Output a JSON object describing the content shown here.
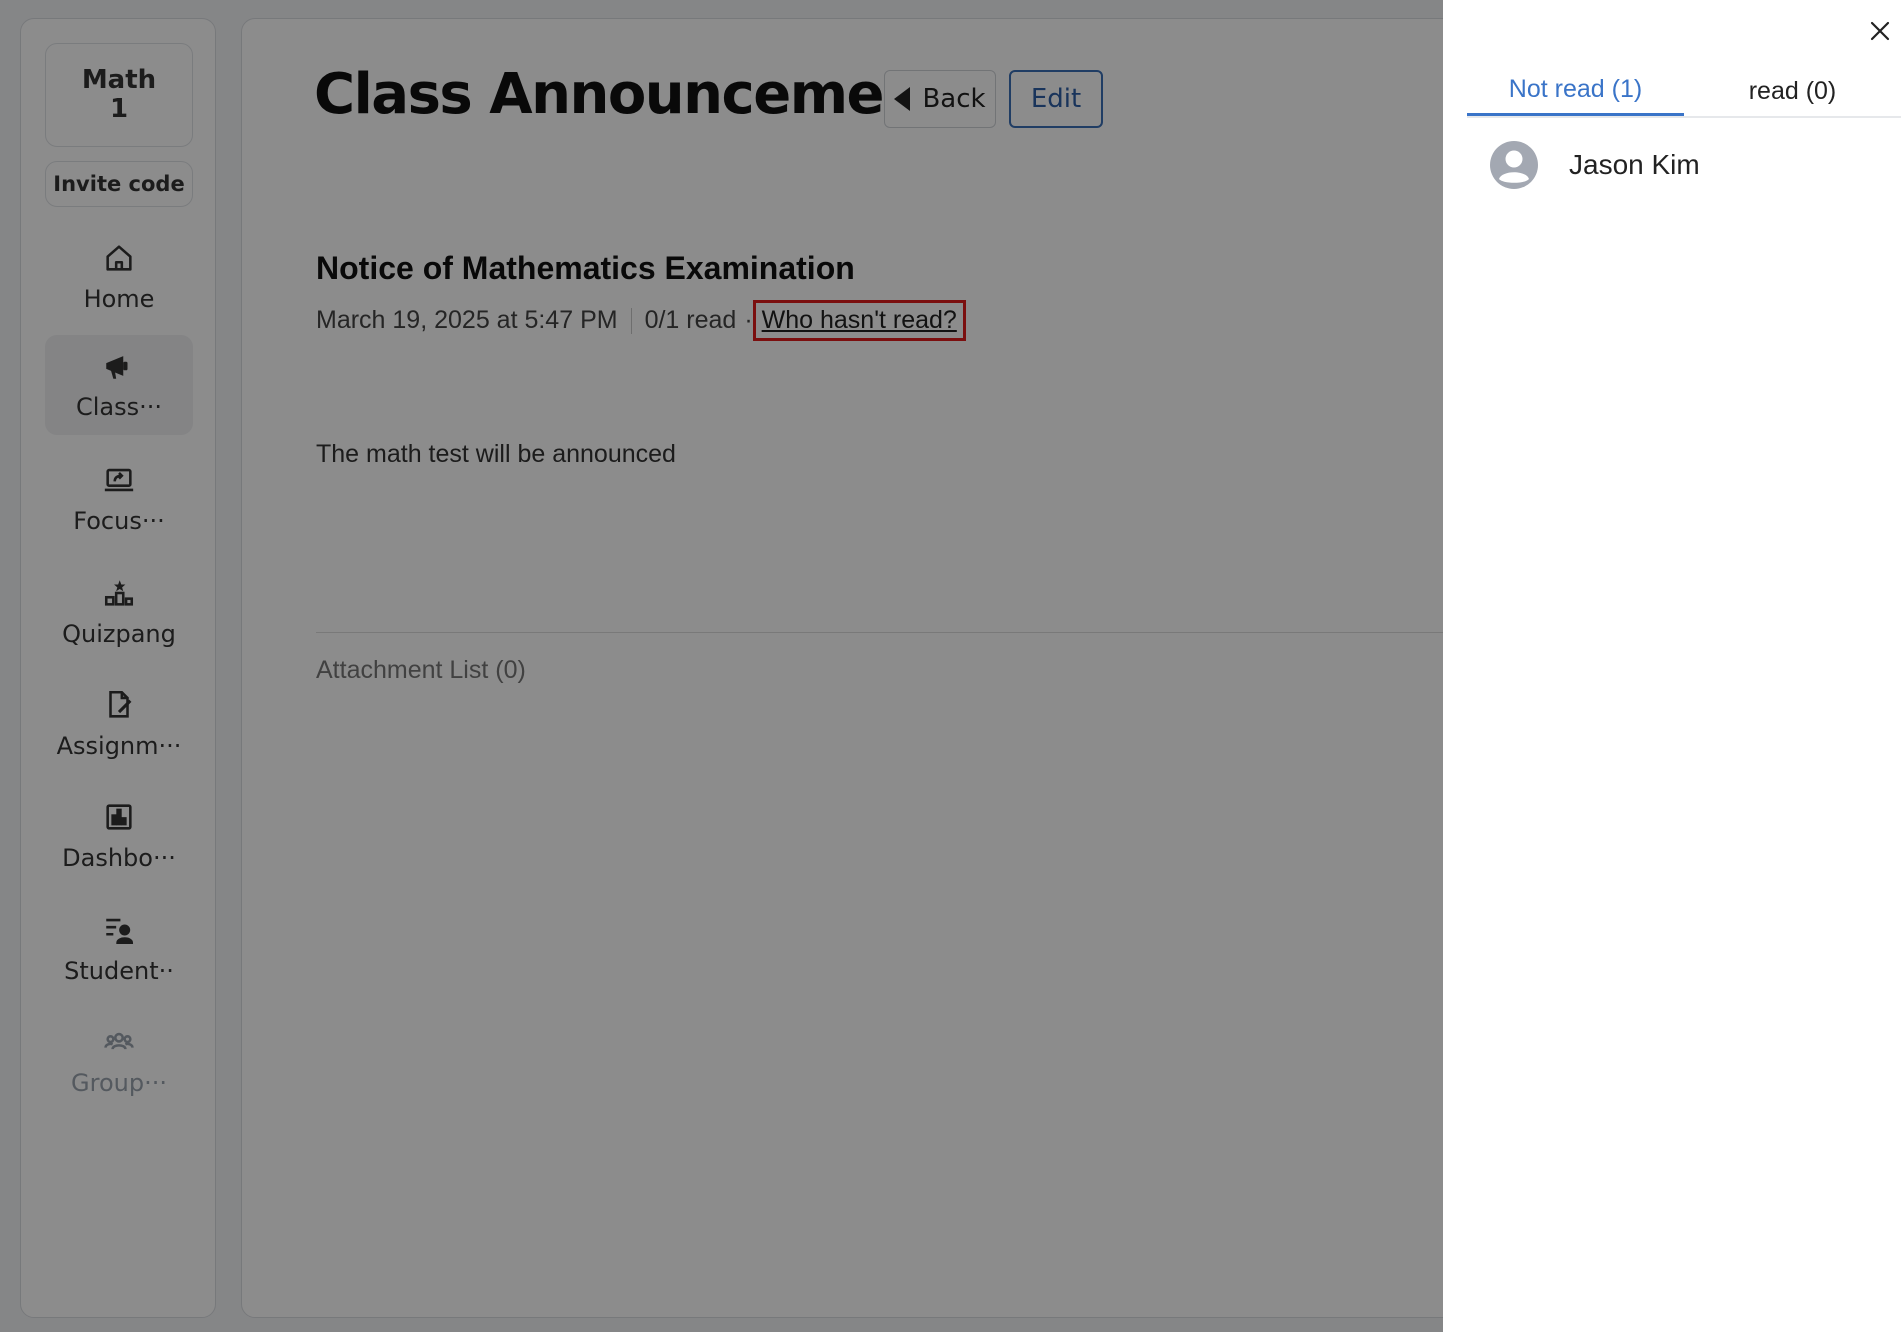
{
  "sidebar": {
    "class_name_line1": "Math",
    "class_name_line2": "1",
    "invite_code_label": "Invite code",
    "items": [
      {
        "label": "Home",
        "icon": "home-icon"
      },
      {
        "label": "Class···",
        "icon": "megaphone-icon",
        "active": true
      },
      {
        "label": "Focus···",
        "icon": "screen-share-icon"
      },
      {
        "label": "Quizpang",
        "icon": "podium-icon"
      },
      {
        "label": "Assignm···",
        "icon": "document-edit-icon"
      },
      {
        "label": "Dashbo···",
        "icon": "bar-chart-icon"
      },
      {
        "label": "Student··",
        "icon": "student-list-icon"
      },
      {
        "label": "Group···",
        "icon": "group-icon",
        "disabled": true
      }
    ]
  },
  "header": {
    "title": "Class Announcement",
    "back_label": "Back",
    "edit_label": "Edit"
  },
  "announcement": {
    "title": "Notice of Mathematics Examination",
    "date": "March 19, 2025 at 5:47 PM",
    "read_count": "0/1 read",
    "dot": "·",
    "who_link": "Who hasn't read?",
    "body": "The math test will be announced",
    "attachment_label": "Attachment List (0)"
  },
  "drawer": {
    "tabs": [
      {
        "label": "Not read (1)",
        "active": true
      },
      {
        "label": "read (0)",
        "active": false
      }
    ],
    "readers": [
      {
        "name": "Jason Kim",
        "icon": "user-avatar-icon"
      }
    ]
  },
  "colors": {
    "accent": "#3a74c8",
    "highlight": "#e01c1c",
    "overlay": "rgba(0,0,0,0.45)"
  }
}
